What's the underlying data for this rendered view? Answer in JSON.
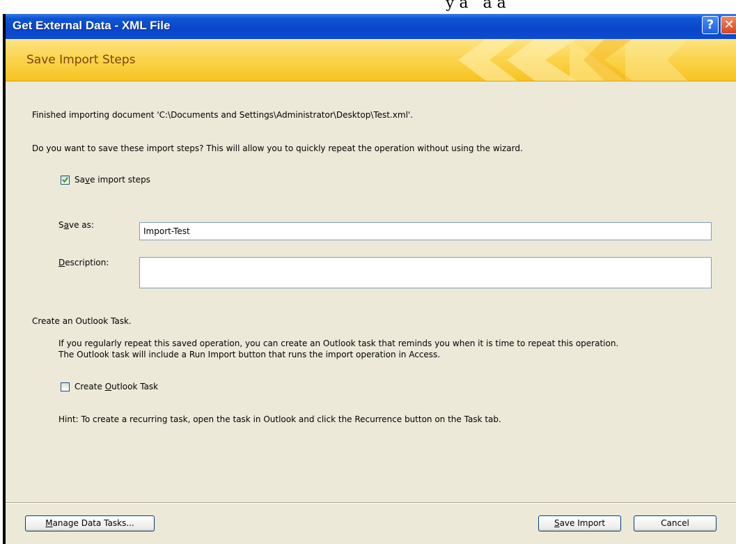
{
  "window": {
    "title": "Get External Data - XML File",
    "help_glyph": "?",
    "close_glyph": "✕",
    "above_text": "y ā ʼ ā ā"
  },
  "banner": {
    "heading": "Save Import Steps"
  },
  "content": {
    "finished_text": "Finished importing document 'C:\\Documents and Settings\\Administrator\\Desktop\\Test.xml'.",
    "question_text": "Do you want to save these import steps? This will allow you to quickly repeat the operation without using the wizard.",
    "save_steps": {
      "pre": "Sa",
      "u": "v",
      "post": "e import steps",
      "checked": true
    },
    "save_as": {
      "pre": "S",
      "u": "a",
      "post": "ve as:",
      "value": "Import-Test"
    },
    "description": {
      "u": "D",
      "post": "escription:",
      "value": ""
    },
    "outlook_heading": "Create an Outlook Task.",
    "outlook_line1": "If you regularly repeat this saved operation, you can create an Outlook task that reminds you when it is time to repeat this operation.",
    "outlook_line2": "The Outlook task will include a Run Import button that runs the import operation in Access.",
    "create_task": {
      "pre": "Create ",
      "u": "O",
      "post": "utlook Task",
      "checked": false
    },
    "hint_text": "Hint: To create a recurring task, open the task in Outlook and click the Recurrence button on the Task tab."
  },
  "footer": {
    "manage": {
      "u": "M",
      "post": "anage Data Tasks..."
    },
    "save_import": {
      "u": "S",
      "post": "ave Import"
    },
    "cancel": "Cancel"
  },
  "colors": {
    "title_blue": "#0a45c8",
    "banner_yellow": "#fbd34a",
    "dialog_bg": "#ece9d8",
    "heading_brown": "#7a4408"
  }
}
